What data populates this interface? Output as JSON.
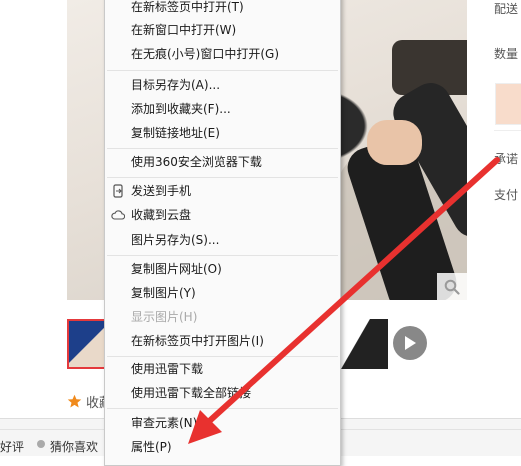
{
  "context_menu": {
    "items": [
      {
        "label": "在新标签页中打开(T)",
        "disabled": false
      },
      {
        "label": "在新窗口中打开(W)",
        "disabled": false
      },
      {
        "label": "在无痕(小号)窗口中打开(G)",
        "disabled": false
      },
      {
        "label": "目标另存为(A)...",
        "disabled": false
      },
      {
        "label": "添加到收藏夹(F)...",
        "disabled": false
      },
      {
        "label": "复制链接地址(E)",
        "disabled": false
      },
      {
        "label": "使用360安全浏览器下载",
        "disabled": false
      },
      {
        "label": "发送到手机",
        "disabled": false,
        "icon": "phone-icon"
      },
      {
        "label": "收藏到云盘",
        "disabled": false,
        "icon": "cloud-icon"
      },
      {
        "label": "图片另存为(S)...",
        "disabled": false
      },
      {
        "label": "复制图片网址(O)",
        "disabled": false
      },
      {
        "label": "复制图片(Y)",
        "disabled": false
      },
      {
        "label": "显示图片(H)",
        "disabled": true
      },
      {
        "label": "在新标签页中打开图片(I)",
        "disabled": false
      },
      {
        "label": "使用迅雷下载",
        "disabled": false
      },
      {
        "label": "使用迅雷下载全部链接",
        "disabled": false
      },
      {
        "label": "审查元素(N)",
        "disabled": false
      },
      {
        "label": "属性(P)",
        "disabled": false
      }
    ]
  },
  "page": {
    "right_labels": [
      "配送",
      "数量",
      "承诺",
      "支付"
    ],
    "favorite_text": "收藏",
    "bottom_left_text": "好评",
    "bottom_guess_text": "猜你喜欢"
  },
  "colors": {
    "arrow": "#e8312f",
    "accent_star": "#f08a1c"
  }
}
